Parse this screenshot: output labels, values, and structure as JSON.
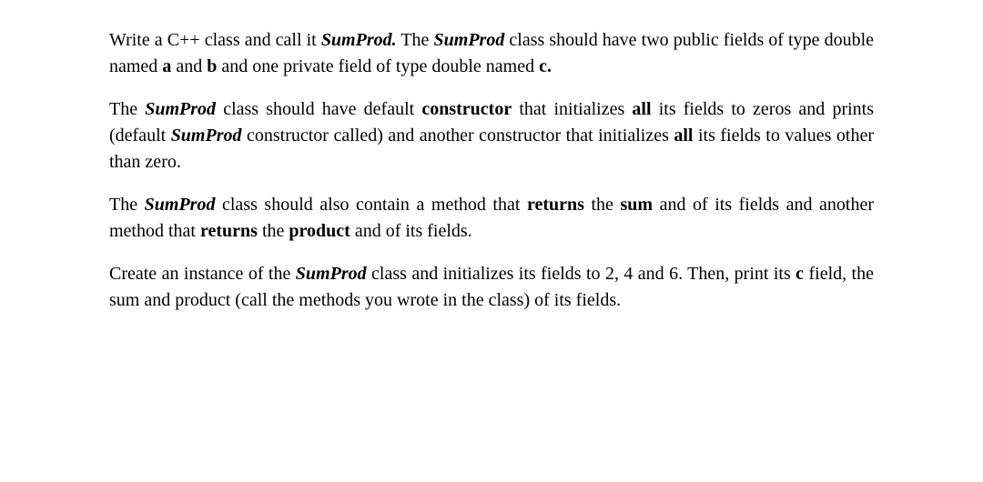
{
  "p1": {
    "t1": "Write a C++ class and call it ",
    "t2": "SumProd.",
    "t3": " The ",
    "t4": "SumProd",
    "t5": " class should have two public fields of type double named ",
    "t6": "a",
    "t7": " and ",
    "t8": "b",
    "t9": " and one private field of type double named ",
    "t10": "c.",
    "t11": ""
  },
  "p2": {
    "t1": "The ",
    "t2": "SumProd",
    "t3": " class should have default ",
    "t4": "constructor",
    "t5": " that initializes ",
    "t6": "all",
    "t7": " its fields to zeros and prints (default ",
    "t8": "SumProd",
    "t9": " constructor called) and another constructor that initializes ",
    "t10": "all",
    "t11": " its fields to values other than zero."
  },
  "p3": {
    "t1": "The ",
    "t2": "SumProd",
    "t3": " class should also contain a method that ",
    "t4": "returns",
    "t5": " the ",
    "t6": "sum",
    "t7": " and of its fields and another method that ",
    "t8": "returns",
    "t9": " the ",
    "t10": "product",
    "t11": " and of its fields."
  },
  "p4": {
    "t1": "Create an instance of the ",
    "t2": "SumProd",
    "t3": " class and initializes its fields to 2, 4 and 6. Then, print its ",
    "t4": "c",
    "t5": " field, the sum and product (call the methods you wrote in the class) of its fields."
  }
}
